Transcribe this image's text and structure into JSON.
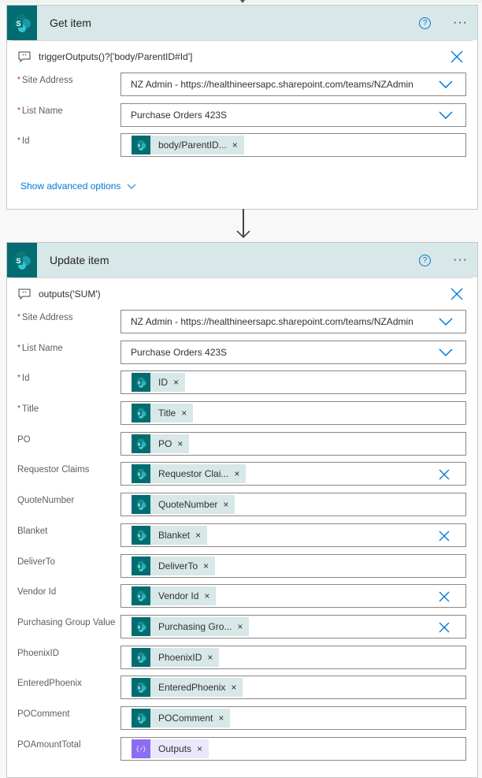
{
  "get_item": {
    "title": "Get item",
    "comment": "triggerOutputs()?['body/ParentID#Id']",
    "fields": [
      {
        "label": "Site Address",
        "required": true,
        "type": "dropdown",
        "value": "NZ Admin - https://healthineersapc.sharepoint.com/teams/NZAdmin"
      },
      {
        "label": "List Name",
        "required": true,
        "type": "dropdown",
        "value": "Purchase Orders 423S"
      },
      {
        "label": "Id",
        "required": true,
        "type": "token",
        "token": "body/ParentID...",
        "token_icon": "sharepoint-icon"
      }
    ],
    "advanced_label": "Show advanced options"
  },
  "update_item": {
    "title": "Update item",
    "comment": "outputs('SUM')",
    "fields": [
      {
        "label": "Site Address",
        "required": true,
        "type": "dropdown",
        "value": "NZ Admin - https://healthineersapc.sharepoint.com/teams/NZAdmin"
      },
      {
        "label": "List Name",
        "required": true,
        "type": "dropdown",
        "value": "Purchase Orders 423S"
      },
      {
        "label": "Id",
        "required": true,
        "type": "token",
        "token": "ID"
      },
      {
        "label": "Title",
        "required": true,
        "type": "token",
        "token": "Title"
      },
      {
        "label": "PO",
        "required": false,
        "type": "token",
        "token": "PO"
      },
      {
        "label": "Requestor Claims",
        "required": false,
        "type": "token",
        "token": "Requestor Clai...",
        "clearable": true
      },
      {
        "label": "QuoteNumber",
        "required": false,
        "type": "token",
        "token": "QuoteNumber"
      },
      {
        "label": "Blanket",
        "required": false,
        "type": "token",
        "token": "Blanket",
        "clearable": true
      },
      {
        "label": "DeliverTo",
        "required": false,
        "type": "token",
        "token": "DeliverTo"
      },
      {
        "label": "Vendor Id",
        "required": false,
        "type": "token",
        "token": "Vendor Id",
        "clearable": true
      },
      {
        "label": "Purchasing Group Value",
        "required": false,
        "type": "token",
        "token": "Purchasing Gro...",
        "clearable": true
      },
      {
        "label": "PhoenixID",
        "required": false,
        "type": "token",
        "token": "PhoenixID"
      },
      {
        "label": "EnteredPhoenix",
        "required": false,
        "type": "token",
        "token": "EnteredPhoenix"
      },
      {
        "label": "POComment",
        "required": false,
        "type": "token",
        "token": "POComment"
      },
      {
        "label": "POAmountTotal",
        "required": false,
        "type": "token",
        "token": "Outputs",
        "token_style": "expression"
      }
    ]
  },
  "glyphs": {
    "required": "*",
    "remove": "×",
    "help": "?",
    "more": "···"
  },
  "colors": {
    "sharepoint": "#036c70",
    "header_bg": "#d8e7e7",
    "accent": "#0078d4",
    "expression": "#8c6cf2"
  }
}
